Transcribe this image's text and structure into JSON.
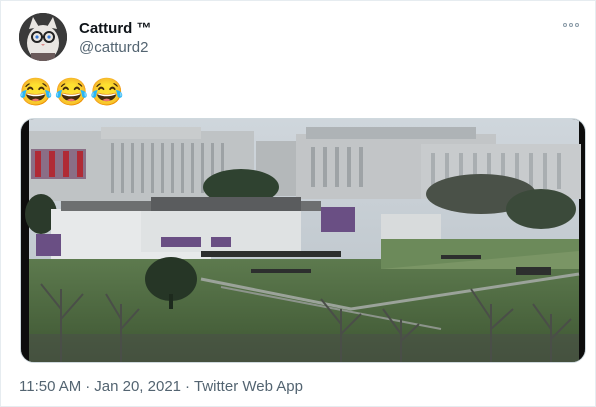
{
  "user": {
    "display_name": "Catturd ™",
    "handle": "@catturd2",
    "avatar_icon": "cat-avatar-icon"
  },
  "tweet": {
    "text": "😂😂😂",
    "media_alt": "photo"
  },
  "meta": {
    "time": "11:50 AM",
    "separator": "·",
    "date": "Jan 20, 2021",
    "source": "Twitter Web App"
  },
  "colors": {
    "secondary_text": "#536471",
    "border": "#cfd9de"
  }
}
